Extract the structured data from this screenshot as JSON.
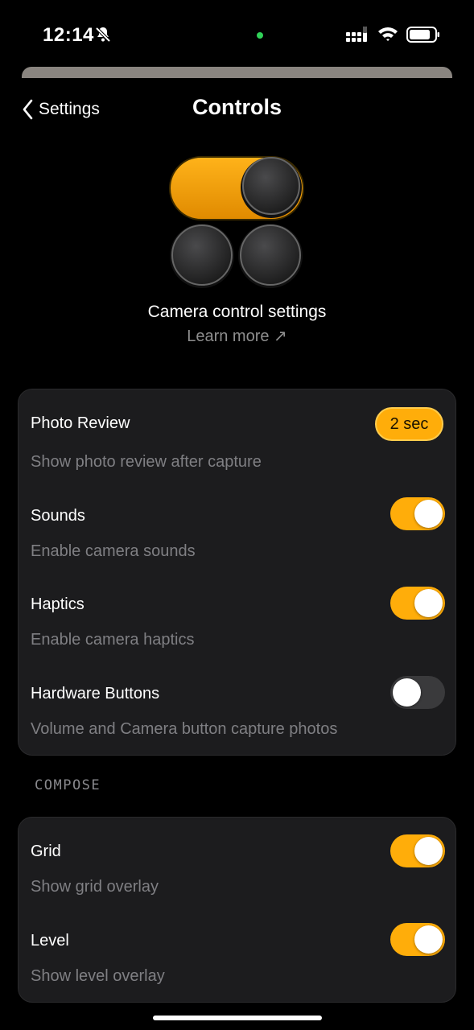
{
  "status": {
    "time": "12:14"
  },
  "nav": {
    "back_label": "Settings",
    "title": "Controls"
  },
  "hero": {
    "caption": "Camera control settings",
    "learn_more": "Learn more ↗"
  },
  "colors": {
    "accent": "#ffad0a",
    "card_bg": "#1c1c1e",
    "background": "#000000",
    "secondary_text": "#7f7f83"
  },
  "card1": {
    "rows": [
      {
        "title": "Photo Review",
        "subtitle": "Show photo review after capture",
        "control": "pill",
        "value": "2 sec"
      },
      {
        "title": "Sounds",
        "subtitle": "Enable camera sounds",
        "control": "toggle",
        "on": true
      },
      {
        "title": "Haptics",
        "subtitle": "Enable camera haptics",
        "control": "toggle",
        "on": true
      },
      {
        "title": "Hardware Buttons",
        "subtitle": "Volume and Camera button capture photos",
        "control": "toggle",
        "on": false
      }
    ]
  },
  "section": {
    "compose_label": "COMPOSE"
  },
  "card2": {
    "rows": [
      {
        "title": "Grid",
        "subtitle": "Show grid overlay",
        "control": "toggle",
        "on": true
      },
      {
        "title": "Level",
        "subtitle": "Show level overlay",
        "control": "toggle",
        "on": true
      }
    ]
  }
}
